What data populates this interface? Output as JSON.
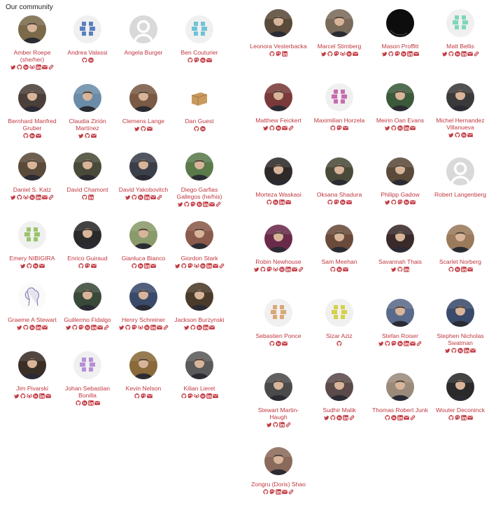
{
  "heading": "Our community",
  "colors": {
    "accent": "#c0373f"
  },
  "columns": [
    {
      "members": [
        {
          "name": "Amber Roepe (she/her)",
          "avatar": "photo",
          "color": "#7a6a4a",
          "icons": [
            "twitter",
            "github",
            "orcid",
            "gitlab",
            "linkedin",
            "email",
            "link"
          ]
        },
        {
          "name": "Bernhard Manfred Gruber",
          "avatar": "photo",
          "color": "#4b3f3a",
          "icons": [
            "github",
            "orcid",
            "email"
          ]
        },
        {
          "name": "Daniel S. Katz",
          "avatar": "photo",
          "color": "#5a4a3a",
          "icons": [
            "twitter",
            "github",
            "gitlab",
            "orcid",
            "linkedin",
            "email",
            "link"
          ]
        },
        {
          "name": "Emery NIBIGIRA",
          "avatar": "identicon",
          "color": "#9bc36b",
          "icons": [
            "twitter",
            "github",
            "orcid",
            "email"
          ]
        },
        {
          "name": "Graeme A Stewart",
          "avatar": "sketch",
          "color": "#e8e4ee",
          "icons": [
            "twitter",
            "github",
            "orcid",
            "linkedin",
            "email"
          ]
        },
        {
          "name": "Jim Pivarski",
          "avatar": "photo",
          "color": "#3a2e26",
          "icons": [
            "twitter",
            "github",
            "gitlab",
            "orcid",
            "linkedin",
            "email"
          ]
        }
      ]
    },
    {
      "members": [
        {
          "name": "Andrea Valassi",
          "avatar": "identicon",
          "color": "#5b7fc0",
          "icons": [
            "github",
            "orcid"
          ]
        },
        {
          "name": "Claudia Zirión Martínez",
          "avatar": "photo",
          "color": "#6a8ca8",
          "icons": [
            "twitter",
            "github",
            "email"
          ]
        },
        {
          "name": "David Chamont",
          "avatar": "photo",
          "color": "#4a4a3a",
          "icons": [
            "github",
            "linkedin"
          ]
        },
        {
          "name": "Enrico Guiraud",
          "avatar": "photo",
          "color": "#2a2a2a",
          "icons": [
            "github",
            "mastodon",
            "email"
          ]
        },
        {
          "name": "Guillermo Fidalgo",
          "avatar": "photo",
          "color": "#3a4a3a",
          "icons": [
            "twitter",
            "github",
            "mastodon",
            "orcid",
            "linkedin",
            "email",
            "link"
          ]
        },
        {
          "name": "Johan Sebastian Bonilla",
          "avatar": "identicon",
          "color": "#b58fd6",
          "icons": [
            "github",
            "orcid",
            "linkedin",
            "email"
          ]
        }
      ]
    },
    {
      "members": [
        {
          "name": "Angela Burger",
          "avatar": "default",
          "color": "#d9d9d9",
          "icons": []
        },
        {
          "name": "Clemens Lange",
          "avatar": "photo",
          "color": "#7a5a45",
          "icons": [
            "twitter",
            "github",
            "email"
          ]
        },
        {
          "name": "David Yakobovitch",
          "avatar": "photo",
          "color": "#3a3f4a",
          "icons": [
            "twitter",
            "github",
            "orcid",
            "linkedin",
            "email",
            "link"
          ]
        },
        {
          "name": "Gianluca Bianco",
          "avatar": "photo",
          "color": "#8a9a6a",
          "icons": [
            "github",
            "orcid",
            "linkedin",
            "email"
          ]
        },
        {
          "name": "Henry Schreiner",
          "avatar": "photo",
          "color": "#3a4a6a",
          "icons": [
            "twitter",
            "github",
            "mastodon",
            "gitlab",
            "orcid",
            "linkedin",
            "email",
            "link"
          ]
        },
        {
          "name": "Kevin Nelson",
          "avatar": "photo",
          "color": "#8a6a3a",
          "icons": [
            "github",
            "mastodon",
            "email"
          ]
        }
      ]
    },
    {
      "members": [
        {
          "name": "Ben Couturier",
          "avatar": "identicon",
          "color": "#6fc3d6",
          "icons": [
            "github",
            "mastodon",
            "orcid",
            "email"
          ]
        },
        {
          "name": "Dan Guest",
          "avatar": "box",
          "color": "#c89a5e",
          "icons": [
            "github",
            "orcid"
          ]
        },
        {
          "name": "Diego Garfias Gallegos (he/his)",
          "avatar": "photo",
          "color": "#5a7a4a",
          "icons": [
            "twitter",
            "github",
            "mastodon",
            "orcid",
            "linkedin",
            "email",
            "link"
          ]
        },
        {
          "name": "Giordon Stark",
          "avatar": "photo",
          "color": "#8a5a4a",
          "icons": [
            "twitter",
            "github",
            "mastodon",
            "gitlab",
            "orcid",
            "linkedin",
            "email",
            "link"
          ]
        },
        {
          "name": "Jackson Burzynski",
          "avatar": "photo",
          "color": "#4a3a2a",
          "icons": [
            "twitter",
            "github",
            "orcid",
            "linkedin",
            "email"
          ]
        },
        {
          "name": "Kilian Lieret",
          "avatar": "photo",
          "color": "#5a5a5a",
          "icons": [
            "github",
            "mastodon",
            "gitlab",
            "orcid",
            "linkedin",
            "email"
          ]
        }
      ]
    },
    {
      "members": [
        {
          "name": "Leonora Vesterbacka",
          "avatar": "photo",
          "color": "#5a4a3a",
          "icons": [
            "github",
            "mastodon",
            "linkedin"
          ]
        },
        {
          "name": "Matthew Feickert",
          "avatar": "photo",
          "color": "#7a3a3a",
          "icons": [
            "twitter",
            "github",
            "orcid",
            "email",
            "link"
          ]
        },
        {
          "name": "Morteza Waskasi",
          "avatar": "photo",
          "color": "#2e2a2a",
          "icons": [
            "github",
            "orcid",
            "linkedin",
            "email"
          ]
        },
        {
          "name": "Robin Newhouse",
          "avatar": "photo",
          "color": "#6a2a4a",
          "icons": [
            "twitter",
            "github",
            "mastodon",
            "gitlab",
            "orcid",
            "linkedin",
            "email",
            "link"
          ]
        },
        {
          "name": "Sebastien Ponce",
          "avatar": "identicon",
          "color": "#d9a87a",
          "icons": [
            "github",
            "orcid",
            "email"
          ]
        },
        {
          "name": "Stewart Martin-Haugh",
          "avatar": "photo",
          "color": "#4a4a4a",
          "icons": [
            "twitter",
            "github",
            "linkedin",
            "link"
          ]
        },
        {
          "name": "Zongru (Doris) Shao",
          "avatar": "photo",
          "color": "#8a6a5a",
          "icons": [
            "github",
            "mastodon",
            "linkedin",
            "email",
            "link"
          ]
        }
      ]
    },
    {
      "members": [
        {
          "name": "Marcel Stimberg",
          "avatar": "photo",
          "color": "#7a6a5a",
          "icons": [
            "twitter",
            "github",
            "mastodon",
            "gitlab",
            "orcid",
            "email"
          ]
        },
        {
          "name": "Maximilian Horzela",
          "avatar": "identicon",
          "color": "#c86bb0",
          "icons": [
            "github",
            "mastodon",
            "email"
          ]
        },
        {
          "name": "Oksana Shadura",
          "avatar": "photo",
          "color": "#4a4a3a",
          "icons": [
            "github",
            "mastodon",
            "orcid",
            "email"
          ]
        },
        {
          "name": "Sam Meehan",
          "avatar": "photo",
          "color": "#6a4a3a",
          "icons": [
            "github",
            "orcid",
            "email"
          ]
        },
        {
          "name": "Sizar Aziz",
          "avatar": "identicon",
          "color": "#d3d24a",
          "icons": [
            "github"
          ]
        },
        {
          "name": "Sudhir Malik",
          "avatar": "photo",
          "color": "#5a4a4a",
          "icons": [
            "twitter",
            "github",
            "orcid",
            "linkedin",
            "link"
          ]
        }
      ]
    },
    {
      "members": [
        {
          "name": "Mason Proffitt",
          "avatar": "dark",
          "color": "#0d0d0d",
          "icons": [
            "twitter",
            "github",
            "mastodon",
            "orcid",
            "linkedin",
            "email"
          ]
        },
        {
          "name": "Meirin Oan Evans",
          "avatar": "photo",
          "color": "#3a5a3a",
          "icons": [
            "twitter",
            "github",
            "orcid",
            "linkedin",
            "email"
          ]
        },
        {
          "name": "Philipp Gadow",
          "avatar": "photo",
          "color": "#5a4a3a",
          "icons": [
            "twitter",
            "github",
            "mastodon",
            "orcid",
            "email"
          ]
        },
        {
          "name": "Savannah Thais",
          "avatar": "photo",
          "color": "#3a2a2a",
          "icons": [
            "twitter",
            "github",
            "linkedin"
          ]
        },
        {
          "name": "Stefan Roiser",
          "avatar": "photo",
          "color": "#5a6a8a",
          "icons": [
            "twitter",
            "github",
            "mastodon",
            "orcid",
            "linkedin",
            "email",
            "link"
          ]
        },
        {
          "name": "Thomas Robert Junk",
          "avatar": "photo",
          "color": "#9a8a7a",
          "icons": [
            "github",
            "orcid",
            "linkedin",
            "email",
            "link"
          ]
        }
      ]
    },
    {
      "members": [
        {
          "name": "Matt Bellis",
          "avatar": "identicon",
          "color": "#7fd6b8",
          "icons": [
            "twitter",
            "github",
            "orcid",
            "linkedin",
            "email",
            "link"
          ]
        },
        {
          "name": "Michel Hernandez Villanueva",
          "avatar": "photo",
          "color": "#3a3a3a",
          "icons": [
            "twitter",
            "github",
            "orcid",
            "email"
          ]
        },
        {
          "name": "Robert Langenberg",
          "avatar": "default",
          "color": "#d9d9d9",
          "icons": []
        },
        {
          "name": "Scarlet Norberg",
          "avatar": "photo",
          "color": "#9a7a5a",
          "icons": [
            "github",
            "orcid",
            "linkedin",
            "email"
          ]
        },
        {
          "name": "Stephen Nicholas Swatman",
          "avatar": "photo",
          "color": "#3a4a6a",
          "icons": [
            "twitter",
            "github",
            "orcid",
            "linkedin",
            "email"
          ]
        },
        {
          "name": "Wouter Deconinck",
          "avatar": "photo",
          "color": "#2a2a2a",
          "icons": [
            "github",
            "mastodon",
            "linkedin",
            "email"
          ]
        }
      ]
    }
  ]
}
